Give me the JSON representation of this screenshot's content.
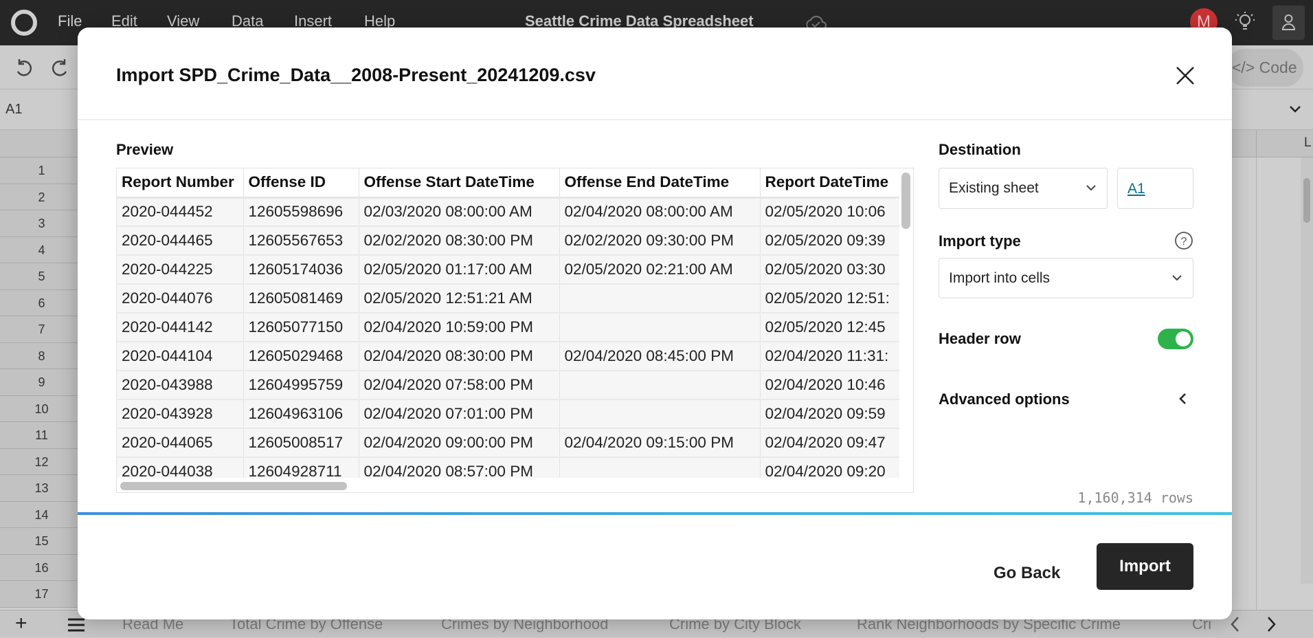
{
  "topbar": {
    "menu": [
      "File",
      "Edit",
      "View",
      "Data",
      "Insert",
      "Help"
    ],
    "title": "Seattle Crime Data Spreadsheet",
    "avatar_initial": "M",
    "avatar_color": "#c83232"
  },
  "toolbar": {
    "code_label": "</> Code"
  },
  "formula_bar": {
    "cell_ref": "A1"
  },
  "grid": {
    "column_visible": "L",
    "rows": [
      "1",
      "2",
      "3",
      "4",
      "5",
      "6",
      "7",
      "8",
      "9",
      "10",
      "11",
      "12",
      "13",
      "14",
      "15",
      "16",
      "17"
    ]
  },
  "sheet_tabs": [
    "Read Me",
    "Total Crime by Offense",
    "Crimes by Neighborhood",
    "Crime by City Block",
    "Rank Neighborhoods by Specific Crime",
    "Cri"
  ],
  "modal": {
    "title": "Import SPD_Crime_Data__2008-Present_20241209.csv",
    "preview_label": "Preview",
    "columns": [
      "Report Number",
      "Offense ID",
      "Offense Start DateTime",
      "Offense End DateTime",
      "Report DateTime"
    ],
    "rows": [
      [
        "2020-044452",
        "12605598696",
        "02/03/2020 08:00:00 AM",
        "02/04/2020 08:00:00 AM",
        "02/05/2020 10:06"
      ],
      [
        "2020-044465",
        "12605567653",
        "02/02/2020 08:30:00 PM",
        "02/02/2020 09:30:00 PM",
        "02/05/2020 09:39"
      ],
      [
        "2020-044225",
        "12605174036",
        "02/05/2020 01:17:00 AM",
        "02/05/2020 02:21:00 AM",
        "02/05/2020 03:30"
      ],
      [
        "2020-044076",
        "12605081469",
        "02/05/2020 12:51:21 AM",
        "",
        "02/05/2020 12:51:"
      ],
      [
        "2020-044142",
        "12605077150",
        "02/04/2020 10:59:00 PM",
        "",
        "02/05/2020 12:45"
      ],
      [
        "2020-044104",
        "12605029468",
        "02/04/2020 08:30:00 PM",
        "02/04/2020 08:45:00 PM",
        "02/04/2020 11:31:"
      ],
      [
        "2020-043988",
        "12604995759",
        "02/04/2020 07:58:00 PM",
        "",
        "02/04/2020 10:46"
      ],
      [
        "2020-043928",
        "12604963106",
        "02/04/2020 07:01:00 PM",
        "",
        "02/04/2020 09:59"
      ],
      [
        "2020-044065",
        "12605008517",
        "02/04/2020 09:00:00 PM",
        "02/04/2020 09:15:00 PM",
        "02/04/2020 09:47"
      ],
      [
        "2020-044038",
        "12604928711",
        "02/04/2020 08:57:00 PM",
        "",
        "02/04/2020 09:20"
      ]
    ],
    "destination_label": "Destination",
    "destination_value": "Existing sheet",
    "destination_cell": "A1",
    "import_type_label": "Import type",
    "import_type_value": "Import into cells",
    "header_row_label": "Header row",
    "header_row_enabled": true,
    "advanced_label": "Advanced options",
    "row_count": "1,160,314 rows",
    "go_back_label": "Go Back",
    "import_label": "Import",
    "toggle_color": "#2db34a"
  }
}
